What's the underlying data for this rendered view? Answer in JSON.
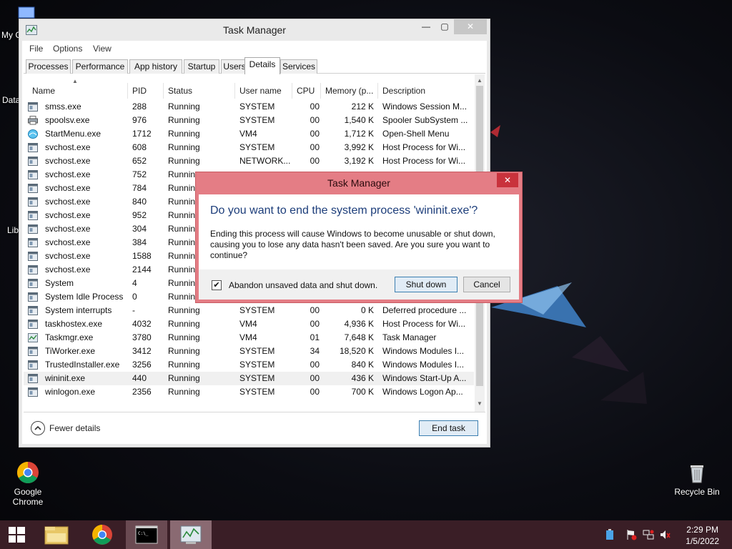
{
  "desktop": {
    "partial_labels": [
      "My C",
      "Data",
      "Lib"
    ],
    "icons": [
      {
        "name": "chrome",
        "label_line1": "Google",
        "label_line2": "Chrome"
      },
      {
        "name": "recycle-bin",
        "label": "Recycle Bin"
      }
    ]
  },
  "window": {
    "title": "Task Manager",
    "controls": {
      "minimize": "—",
      "maximize": "▢",
      "close": "✕"
    }
  },
  "menu": [
    "File",
    "Options",
    "View"
  ],
  "tabs": [
    {
      "label": "Processes",
      "active": false
    },
    {
      "label": "Performance",
      "active": false
    },
    {
      "label": "App history",
      "active": false
    },
    {
      "label": "Startup",
      "active": false
    },
    {
      "label": "Users",
      "active": false
    },
    {
      "label": "Details",
      "active": true
    },
    {
      "label": "Services",
      "active": false
    }
  ],
  "columns": [
    "Name",
    "PID",
    "Status",
    "User name",
    "CPU",
    "Memory (p...",
    "Description"
  ],
  "rows": [
    {
      "name": "smss.exe",
      "pid": "288",
      "status": "Running",
      "user": "SYSTEM",
      "cpu": "00",
      "mem": "212 K",
      "desc": "Windows Session M...",
      "icon": "window"
    },
    {
      "name": "spoolsv.exe",
      "pid": "976",
      "status": "Running",
      "user": "SYSTEM",
      "cpu": "00",
      "mem": "1,540 K",
      "desc": "Spooler SubSystem ...",
      "icon": "printer"
    },
    {
      "name": "StartMenu.exe",
      "pid": "1712",
      "status": "Running",
      "user": "VM4",
      "cpu": "00",
      "mem": "1,712 K",
      "desc": "Open-Shell Menu",
      "icon": "shell"
    },
    {
      "name": "svchost.exe",
      "pid": "608",
      "status": "Running",
      "user": "SYSTEM",
      "cpu": "00",
      "mem": "3,992 K",
      "desc": "Host Process for Wi...",
      "icon": "window"
    },
    {
      "name": "svchost.exe",
      "pid": "652",
      "status": "Running",
      "user": "NETWORK...",
      "cpu": "00",
      "mem": "3,192 K",
      "desc": "Host Process for Wi...",
      "icon": "window"
    },
    {
      "name": "svchost.exe",
      "pid": "752",
      "status": "Running",
      "user": "",
      "cpu": "",
      "mem": "",
      "desc": "",
      "icon": "window"
    },
    {
      "name": "svchost.exe",
      "pid": "784",
      "status": "Running",
      "user": "",
      "cpu": "",
      "mem": "",
      "desc": "",
      "icon": "window"
    },
    {
      "name": "svchost.exe",
      "pid": "840",
      "status": "Running",
      "user": "",
      "cpu": "",
      "mem": "",
      "desc": "",
      "icon": "window"
    },
    {
      "name": "svchost.exe",
      "pid": "952",
      "status": "Running",
      "user": "",
      "cpu": "",
      "mem": "",
      "desc": "",
      "icon": "window"
    },
    {
      "name": "svchost.exe",
      "pid": "304",
      "status": "Running",
      "user": "",
      "cpu": "",
      "mem": "",
      "desc": "",
      "icon": "window"
    },
    {
      "name": "svchost.exe",
      "pid": "384",
      "status": "Running",
      "user": "",
      "cpu": "",
      "mem": "",
      "desc": "",
      "icon": "window"
    },
    {
      "name": "svchost.exe",
      "pid": "1588",
      "status": "Running",
      "user": "",
      "cpu": "",
      "mem": "",
      "desc": "",
      "icon": "window"
    },
    {
      "name": "svchost.exe",
      "pid": "2144",
      "status": "Running",
      "user": "",
      "cpu": "",
      "mem": "",
      "desc": "",
      "icon": "window"
    },
    {
      "name": "System",
      "pid": "4",
      "status": "Running",
      "user": "",
      "cpu": "",
      "mem": "",
      "desc": "",
      "icon": "window"
    },
    {
      "name": "System Idle Process",
      "pid": "0",
      "status": "Running",
      "user": "",
      "cpu": "",
      "mem": "",
      "desc": "",
      "icon": "window"
    },
    {
      "name": "System interrupts",
      "pid": "-",
      "status": "Running",
      "user": "SYSTEM",
      "cpu": "00",
      "mem": "0 K",
      "desc": "Deferred procedure ...",
      "icon": "window"
    },
    {
      "name": "taskhostex.exe",
      "pid": "4032",
      "status": "Running",
      "user": "VM4",
      "cpu": "00",
      "mem": "4,936 K",
      "desc": "Host Process for Wi...",
      "icon": "window"
    },
    {
      "name": "Taskmgr.exe",
      "pid": "3780",
      "status": "Running",
      "user": "VM4",
      "cpu": "01",
      "mem": "7,648 K",
      "desc": "Task Manager",
      "icon": "taskmgr"
    },
    {
      "name": "TiWorker.exe",
      "pid": "3412",
      "status": "Running",
      "user": "SYSTEM",
      "cpu": "34",
      "mem": "18,520 K",
      "desc": "Windows Modules I...",
      "icon": "window"
    },
    {
      "name": "TrustedInstaller.exe",
      "pid": "3256",
      "status": "Running",
      "user": "SYSTEM",
      "cpu": "00",
      "mem": "840 K",
      "desc": "Windows Modules I...",
      "icon": "window"
    },
    {
      "name": "wininit.exe",
      "pid": "440",
      "status": "Running",
      "user": "SYSTEM",
      "cpu": "00",
      "mem": "436 K",
      "desc": "Windows Start-Up A...",
      "icon": "window",
      "selected": true
    },
    {
      "name": "winlogon.exe",
      "pid": "2356",
      "status": "Running",
      "user": "SYSTEM",
      "cpu": "00",
      "mem": "700 K",
      "desc": "Windows Logon Ap...",
      "icon": "window"
    }
  ],
  "footer": {
    "fewer_details": "Fewer details",
    "end_task": "End task"
  },
  "dialog": {
    "title": "Task Manager",
    "close": "✕",
    "main": "Do you want to end the system process 'wininit.exe'?",
    "sub": "Ending this process will cause Windows to become unusable or shut down, causing you to lose any data hasn't been saved. Are you sure you want to continue?",
    "checkbox_label": "Abandon unsaved data and shut down.",
    "checkbox_checked": true,
    "checkmark": "✔",
    "shutdown": "Shut down",
    "cancel": "Cancel"
  },
  "taskbar": {
    "time": "2:29 PM",
    "date": "1/5/2022",
    "apps": [
      "file-explorer",
      "chrome",
      "command-prompt",
      "task-manager"
    ]
  },
  "colors": {
    "taskbar": "#3a1e26",
    "dialog_frame": "#e47d85",
    "dialog_close": "#c9323c",
    "instruction_text": "#1c3d7a"
  }
}
